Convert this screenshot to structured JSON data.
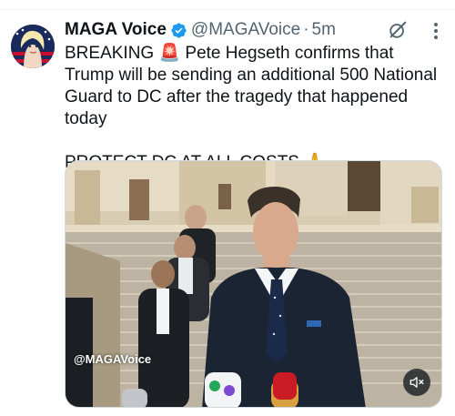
{
  "post": {
    "author_name": "MAGA Voice",
    "author_handle": "@MAGAVoice",
    "separator": "·",
    "timestamp": "5m",
    "text_line1": "BREAKING 🚨 Pete Hegseth confirms that Trump will be sending an additional 500 National Guard to DC after the tragedy that happened today",
    "text_line2": "PROTECT DC AT ALL COSTS 🙏",
    "media": {
      "watermark": "@MAGAVoice"
    }
  },
  "icons": {
    "verified": "verified-badge-icon",
    "grok": "grok-icon",
    "more": "more-options-icon",
    "mute": "volume-muted-icon"
  },
  "colors": {
    "verified_blue": "#1d9bf0",
    "secondary_text": "#536471"
  }
}
